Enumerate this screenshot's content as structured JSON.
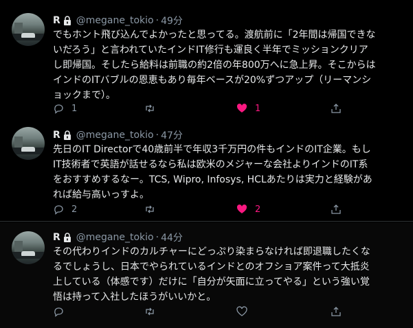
{
  "tweets": [
    {
      "name": "R",
      "handle": "@megane_tokio",
      "time": "49分",
      "lines": [
        "でもホント飛び込んでよかったと思ってる。渡航前に「2年間は帰国できな",
        "いだろう」と言われていたインドIT修行も運良く半年でミッションクリア",
        "し即帰国。そしたら給料は前職の約2倍の年800万へに急上昇。そこからは",
        "インドのITバブルの恩恵もあり毎年ベースが20%ずつアップ（リーマンシ",
        "ョックまで）。"
      ],
      "reply_count": "1",
      "like_count": "1",
      "liked": true
    },
    {
      "name": "R",
      "handle": "@megane_tokio",
      "time": "47分",
      "lines": [
        "先日のIT Directorで40歳前半で年収3千万円の件もインドのIT企業。もし",
        "IT技術者で英語が話せるなら私は欧米のメジャーな会社よりインドのIT系",
        "をおすすめするなー。TCS, Wipro, Infosys, HCLあたりは実力と経験があ",
        "れば給与高いっすよ。"
      ],
      "reply_count": "2",
      "like_count": "2",
      "liked": true
    },
    {
      "name": "R",
      "handle": "@megane_tokio",
      "time": "44分",
      "lines": [
        "その代わりインドのカルチャーにどっぷり染まらなければ即退職したくな",
        "るでしょうし、日本でやられているインドとのオフショア案件って大抵炎",
        "上している（体感です）だけに「自分が矢面に立ってやる」という強い覚",
        "悟は持って入社したほうがいいかと。"
      ],
      "reply_count": "",
      "like_count": "",
      "liked": false
    }
  ],
  "separator": "·",
  "colors": {
    "background": "#000000",
    "text": "#e7e9ea",
    "muted": "#8b98a5",
    "like": "#f91880",
    "divider": "#2f3336"
  }
}
